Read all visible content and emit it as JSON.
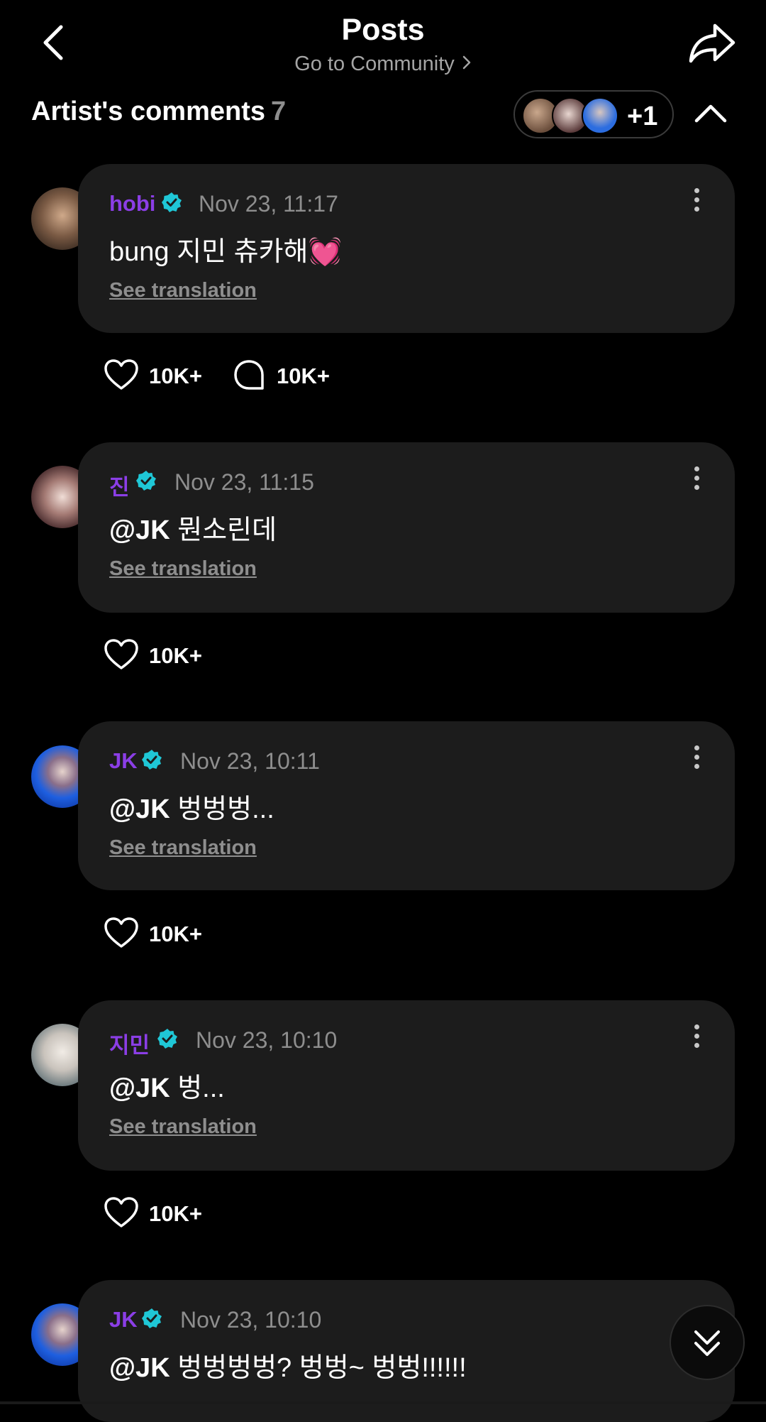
{
  "header": {
    "title": "Posts",
    "community_link": "Go to Community"
  },
  "artist_comments": {
    "label": "Artist's comments",
    "count": "7",
    "more_count": "+1"
  },
  "comments": [
    {
      "author": "hobi",
      "date": "Nov 23, 11:17",
      "text": "bung 지민 츄카해💓",
      "translate": "See translation",
      "likes": "10K+",
      "replies": "10K+"
    },
    {
      "author": "진",
      "date": "Nov 23, 11:15",
      "mention": "@JK",
      "text": " 뭔소린데",
      "translate": "See translation",
      "likes": "10K+"
    },
    {
      "author": "JK",
      "date": "Nov 23, 10:11",
      "mention": "@JK",
      "text": " 벙벙벙...",
      "translate": "See translation",
      "likes": "10K+"
    },
    {
      "author": "지민",
      "date": "Nov 23, 10:10",
      "mention": "@JK",
      "text": " 벙...",
      "translate": "See translation",
      "likes": "10K+"
    },
    {
      "author": "JK",
      "date": "Nov 23, 10:10",
      "mention": "@JK",
      "text": " 벙벙벙벙? 벙벙~ 벙벙!!!!!!"
    }
  ],
  "colors": {
    "background": "#000000",
    "card": "#1c1c1c",
    "author": "#8b3ee6",
    "verified": "#1fc7d6",
    "muted": "#8e8e8e"
  },
  "icons": [
    "back-arrow-icon",
    "share-icon",
    "chevron-right-icon",
    "chevron-up-icon",
    "verified-badge-icon",
    "kebab-menu-icon",
    "heart-icon",
    "comment-icon",
    "double-chevron-down-icon"
  ]
}
